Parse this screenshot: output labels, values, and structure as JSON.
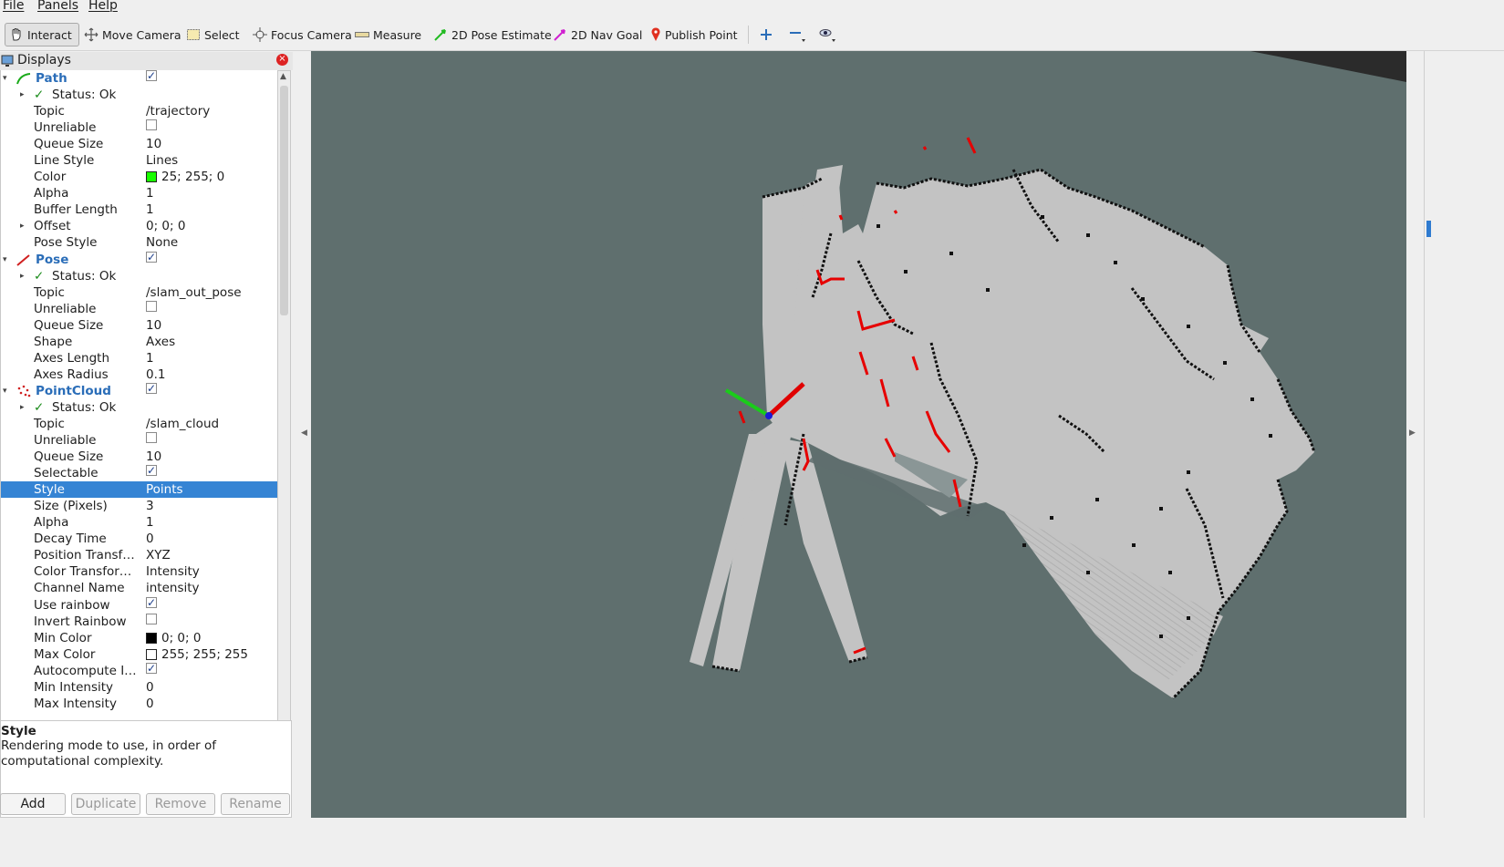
{
  "menu": {
    "file": "File",
    "panels": "Panels",
    "help": "Help"
  },
  "toolbar": {
    "interact": "Interact",
    "move_camera": "Move Camera",
    "select": "Select",
    "focus_camera": "Focus Camera",
    "measure": "Measure",
    "pose_estimate": "2D Pose Estimate",
    "nav_goal": "2D Nav Goal",
    "publish_point": "Publish Point"
  },
  "displays_panel": {
    "title": "Displays",
    "close": "x",
    "rows": [
      {
        "key": "Path",
        "type": "display",
        "checked": true,
        "icon": "path-icon"
      },
      {
        "key": "Status: Ok",
        "type": "status"
      },
      {
        "key": "Topic",
        "value": "/trajectory"
      },
      {
        "key": "Unreliable",
        "checkbox": false
      },
      {
        "key": "Queue Size",
        "value": "10"
      },
      {
        "key": "Line Style",
        "value": "Lines"
      },
      {
        "key": "Color",
        "value": "25; 255; 0",
        "swatch": "#19ff00"
      },
      {
        "key": "Alpha",
        "value": "1"
      },
      {
        "key": "Buffer Length",
        "value": "1"
      },
      {
        "key": "Offset",
        "value": "0; 0; 0",
        "expand": true
      },
      {
        "key": "Pose Style",
        "value": "None"
      },
      {
        "key": "Pose",
        "type": "display",
        "checked": true,
        "icon": "pose-icon"
      },
      {
        "key": "Status: Ok",
        "type": "status"
      },
      {
        "key": "Topic",
        "value": "/slam_out_pose"
      },
      {
        "key": "Unreliable",
        "checkbox": false
      },
      {
        "key": "Queue Size",
        "value": "10"
      },
      {
        "key": "Shape",
        "value": "Axes"
      },
      {
        "key": "Axes Length",
        "value": "1"
      },
      {
        "key": "Axes Radius",
        "value": "0.1"
      },
      {
        "key": "PointCloud",
        "type": "display",
        "checked": true,
        "icon": "pointcloud-icon"
      },
      {
        "key": "Status: Ok",
        "type": "status"
      },
      {
        "key": "Topic",
        "value": "/slam_cloud"
      },
      {
        "key": "Unreliable",
        "checkbox": false
      },
      {
        "key": "Queue Size",
        "value": "10"
      },
      {
        "key": "Selectable",
        "checkbox": true
      },
      {
        "key": "Style",
        "value": "Points",
        "selected": true
      },
      {
        "key": "Size (Pixels)",
        "value": "3"
      },
      {
        "key": "Alpha",
        "value": "1"
      },
      {
        "key": "Decay Time",
        "value": "0"
      },
      {
        "key": "Position Transf…",
        "value": "XYZ"
      },
      {
        "key": "Color Transfor…",
        "value": "Intensity"
      },
      {
        "key": "Channel Name",
        "value": "intensity"
      },
      {
        "key": "Use rainbow",
        "checkbox": true
      },
      {
        "key": "Invert Rainbow",
        "checkbox": false
      },
      {
        "key": "Min Color",
        "value": "0; 0; 0",
        "swatch": "#000000"
      },
      {
        "key": "Max Color",
        "value": "255; 255; 255",
        "swatch": "#ffffff"
      },
      {
        "key": "Autocompute I…",
        "checkbox": true
      },
      {
        "key": "Min Intensity",
        "value": "0"
      },
      {
        "key": "Max Intensity",
        "value": "0"
      }
    ]
  },
  "description": {
    "title": "Style",
    "text": "Rendering mode to use, in order of computational complexity."
  },
  "buttons": {
    "add": "Add",
    "duplicate": "Duplicate",
    "remove": "Remove",
    "rename": "Rename"
  },
  "colors": {
    "viewport_bg": "#5f6f6e",
    "map_free": "#c3c3c3",
    "map_wall": "#111111",
    "selection": "#3584d4",
    "cloud_points": "#e60000"
  }
}
